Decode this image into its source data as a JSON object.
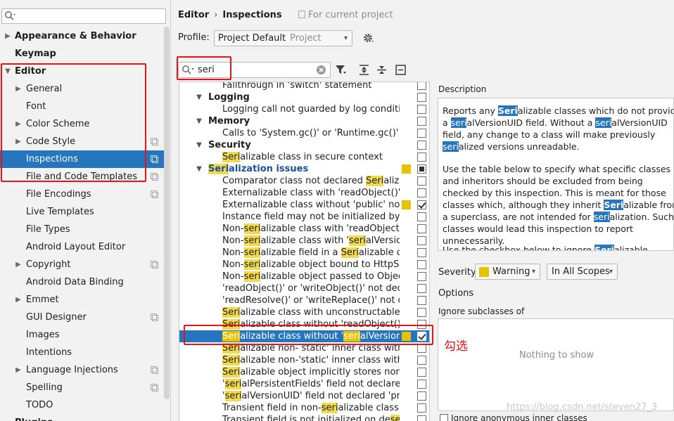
{
  "left_panel": {
    "search_value": "",
    "tree": [
      {
        "label": "Appearance & Behavior",
        "bold": true,
        "arrow": "right",
        "indent": 0,
        "copy": false
      },
      {
        "label": "Keymap",
        "bold": true,
        "arrow": "",
        "indent": 0,
        "copy": false
      },
      {
        "label": "Editor",
        "bold": true,
        "arrow": "down",
        "indent": 0,
        "copy": false
      },
      {
        "label": "General",
        "bold": false,
        "arrow": "right",
        "indent": 1,
        "copy": false
      },
      {
        "label": "Font",
        "bold": false,
        "arrow": "",
        "indent": 1,
        "copy": false
      },
      {
        "label": "Color Scheme",
        "bold": false,
        "arrow": "right",
        "indent": 1,
        "copy": false
      },
      {
        "label": "Code Style",
        "bold": false,
        "arrow": "right",
        "indent": 1,
        "copy": true
      },
      {
        "label": "Inspections",
        "bold": false,
        "arrow": "",
        "indent": 1,
        "copy": true,
        "selected": true
      },
      {
        "label": "File and Code Templates",
        "bold": false,
        "arrow": "",
        "indent": 1,
        "copy": true
      },
      {
        "label": "File Encodings",
        "bold": false,
        "arrow": "",
        "indent": 1,
        "copy": true
      },
      {
        "label": "Live Templates",
        "bold": false,
        "arrow": "",
        "indent": 1,
        "copy": false
      },
      {
        "label": "File Types",
        "bold": false,
        "arrow": "",
        "indent": 1,
        "copy": false
      },
      {
        "label": "Android Layout Editor",
        "bold": false,
        "arrow": "",
        "indent": 1,
        "copy": false
      },
      {
        "label": "Copyright",
        "bold": false,
        "arrow": "right",
        "indent": 1,
        "copy": true
      },
      {
        "label": "Android Data Binding",
        "bold": false,
        "arrow": "",
        "indent": 1,
        "copy": false
      },
      {
        "label": "Emmet",
        "bold": false,
        "arrow": "right",
        "indent": 1,
        "copy": false
      },
      {
        "label": "GUI Designer",
        "bold": false,
        "arrow": "",
        "indent": 1,
        "copy": true
      },
      {
        "label": "Images",
        "bold": false,
        "arrow": "",
        "indent": 1,
        "copy": false
      },
      {
        "label": "Intentions",
        "bold": false,
        "arrow": "",
        "indent": 1,
        "copy": false
      },
      {
        "label": "Language Injections",
        "bold": false,
        "arrow": "right",
        "indent": 1,
        "copy": true
      },
      {
        "label": "Spelling",
        "bold": false,
        "arrow": "",
        "indent": 1,
        "copy": true
      },
      {
        "label": "TODO",
        "bold": false,
        "arrow": "",
        "indent": 1,
        "copy": false
      },
      {
        "label": "Plugins",
        "bold": true,
        "arrow": "",
        "indent": 0,
        "copy": false
      }
    ]
  },
  "header": {
    "crumb_editor": "Editor",
    "crumb_sep": "›",
    "crumb_inspections": "Inspections",
    "for_project": "For current project"
  },
  "profile": {
    "label": "Profile:",
    "value": "Project Default",
    "value_sub": "Project"
  },
  "search": {
    "value": "seri"
  },
  "inspections": [
    {
      "text": "Fallthrough in 'switch' statement",
      "group": false,
      "indent": 2,
      "cb": "none"
    },
    {
      "text": "Logging",
      "group": true,
      "indent": 1,
      "cb": "none",
      "caret": "down"
    },
    {
      "text": "Logging call not guarded by log condition",
      "group": false,
      "indent": 2,
      "cb": "none"
    },
    {
      "text": "Memory",
      "group": true,
      "indent": 1,
      "cb": "none",
      "caret": "down"
    },
    {
      "text": "Calls to 'System.gc()' or 'Runtime.gc()'",
      "group": false,
      "indent": 2,
      "cb": "none"
    },
    {
      "text": "Security",
      "group": true,
      "indent": 1,
      "cb": "none",
      "caret": "down"
    },
    {
      "text": "[Seri]alizable class in secure context",
      "group": false,
      "indent": 2,
      "cb": "none"
    },
    {
      "text": "[Seri]alization issues",
      "group": true,
      "indent": 1,
      "cb": "partial",
      "sev": true,
      "caret": "down",
      "blue": true
    },
    {
      "text": "Comparator class not declared [Seri]alizable",
      "group": false,
      "indent": 2,
      "cb": "none"
    },
    {
      "text": "Externalizable class with 'readObject()' or 'w",
      "group": false,
      "indent": 2,
      "cb": "none"
    },
    {
      "text": "Externalizable class without 'public' no-arg c",
      "group": false,
      "indent": 2,
      "cb": "checked",
      "sev": true
    },
    {
      "text": "Instance field may not be initialized by 'read",
      "group": false,
      "indent": 2,
      "cb": "none"
    },
    {
      "text": "Non-[seri]alizable class with 'readObject()' or",
      "group": false,
      "indent": 2,
      "cb": "none"
    },
    {
      "text": "Non-[seri]alizable class with '[seri]alVersionUID",
      "group": false,
      "indent": 2,
      "cb": "none"
    },
    {
      "text": "Non-[seri]alizable field in a [Seri]alizable class",
      "group": false,
      "indent": 2,
      "cb": "none"
    },
    {
      "text": "Non-[seri]alizable object bound to HttpSessi",
      "group": false,
      "indent": 2,
      "cb": "none"
    },
    {
      "text": "Non-[seri]alizable object passed to ObjectOu",
      "group": false,
      "indent": 2,
      "cb": "none"
    },
    {
      "text": "'readObject()' or 'writeObject()' not declared",
      "group": false,
      "indent": 2,
      "cb": "none"
    },
    {
      "text": "'readResolve()' or 'writeReplace()' not decla",
      "group": false,
      "indent": 2,
      "cb": "none"
    },
    {
      "text": "[Seri]alizable class with unconstructable ance",
      "group": false,
      "indent": 2,
      "cb": "none"
    },
    {
      "text": "[Seri]alizable class without 'readObject()' and",
      "group": false,
      "indent": 2,
      "cb": "none"
    },
    {
      "text": "[Seri]alizable class without '[seri]alVersionUID'",
      "group": false,
      "indent": 2,
      "cb": "checked",
      "sev": true,
      "selected": true
    },
    {
      "text": "[Seri]alizable non- static' inner class with non",
      "group": false,
      "indent": 2,
      "cb": "none"
    },
    {
      "text": "[Seri]alizable non-'static' inner class without '",
      "group": false,
      "indent": 2,
      "cb": "none"
    },
    {
      "text": "[Seri]alizable object implicitly stores non-[Seri]",
      "group": false,
      "indent": 2,
      "cb": "none"
    },
    {
      "text": "'[seri]alPersistentFields' field not declared 'pr",
      "group": false,
      "indent": 2,
      "cb": "none"
    },
    {
      "text": "'[seri]alVersionUID' field not declared 'private",
      "group": false,
      "indent": 2,
      "cb": "none"
    },
    {
      "text": "Transient field in non-[seri]alizable class",
      "group": false,
      "indent": 2,
      "cb": "none"
    },
    {
      "text": "Transient field is not initialized on de[seri]aliz",
      "group": false,
      "indent": 2,
      "cb": "none"
    }
  ],
  "annotation": {
    "text": "勾选",
    "color": "#e8141c"
  },
  "description": {
    "label": "Description",
    "para1": "Reports any [Seri]alizable classes which do not provide a [seri]alVersionUID field. Without a [seri]alVersionUID field, any change to a class will make previously [seri]alized versions unreadable.",
    "para2": "Use the table below to specify what specific classes and inheritors should be excluded from being checked by this inspection. This is meant for those classes which, although they inherit [Seri]alizable from a superclass, are not intended for [seri]alization. Such classes would lead this inspection to report unnecessarily.",
    "para3": "Use the checkbox below to ignore [Seri]alizable"
  },
  "severity": {
    "label": "Severity:",
    "value": "Warning",
    "color": "#e8c100",
    "scope": "In All Scopes"
  },
  "options": {
    "label": "Options",
    "ignore_label": "Ignore subclasses of",
    "empty": "Nothing to show",
    "ignore_anon": "Ignore anonymous inner classes"
  },
  "watermark": "https://blog.csdn.net/steven27_3",
  "colors": {
    "selection": "#2675bf",
    "highlight": "#f2da4f",
    "warning": "#e8c100",
    "annotation_red": "#e8141c"
  }
}
